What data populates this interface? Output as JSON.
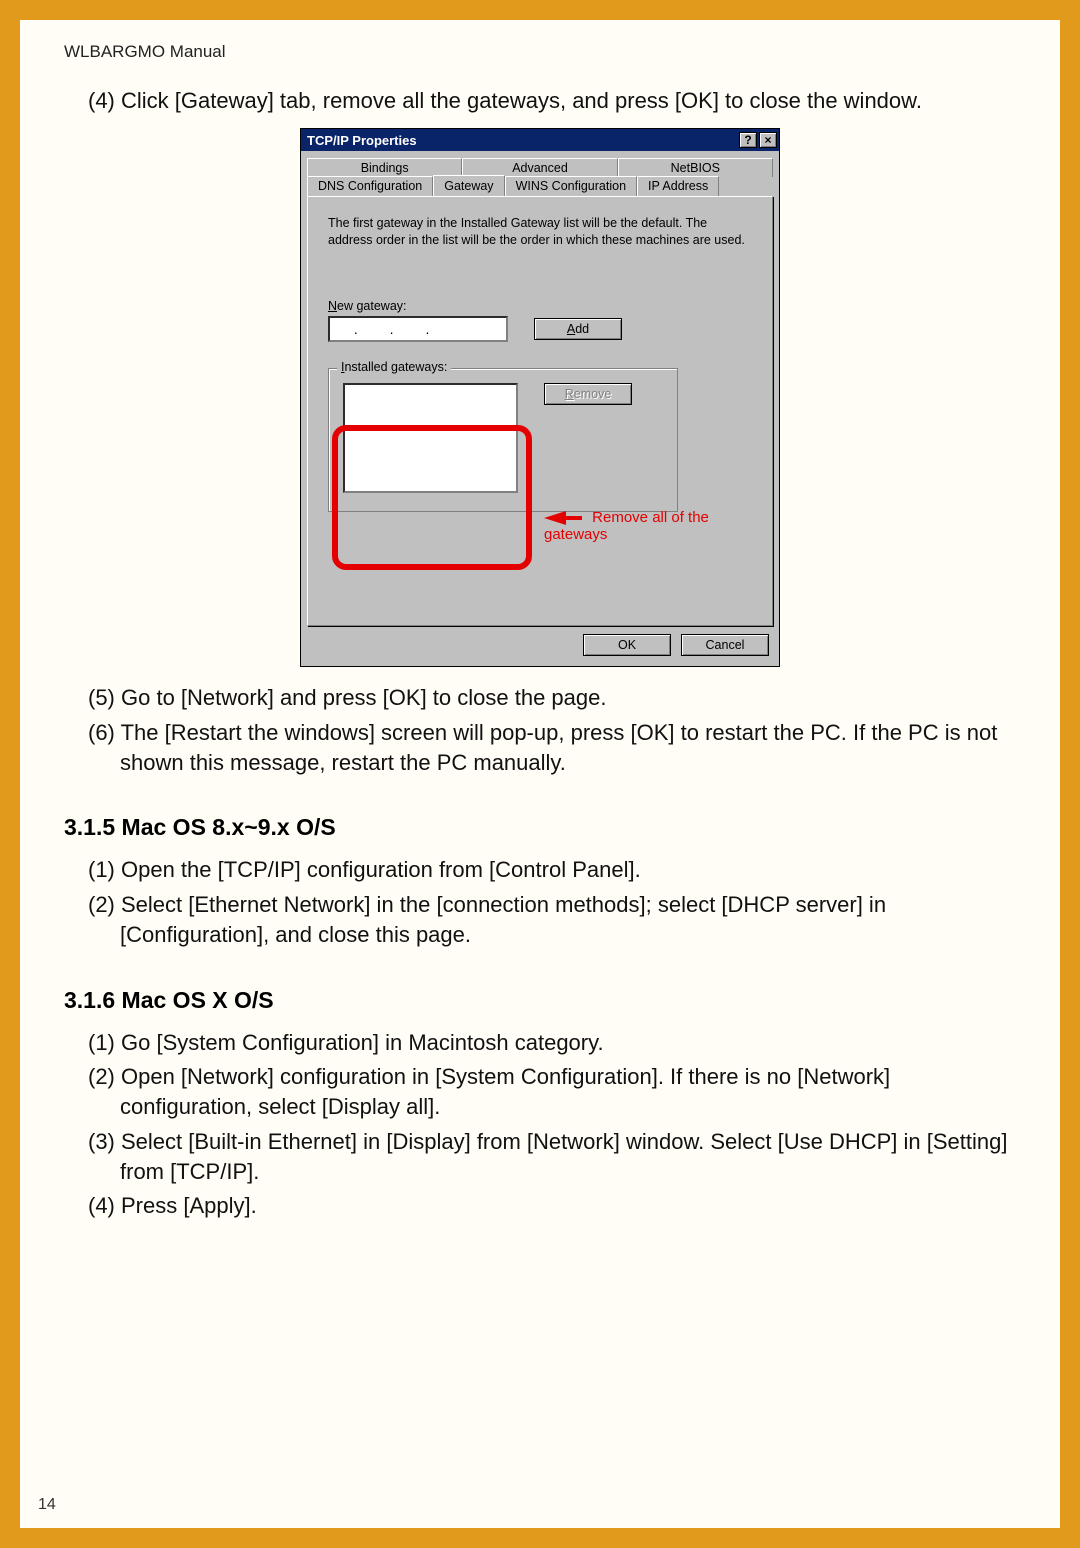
{
  "header": "WLBARGMO Manual",
  "page_number": "14",
  "steps_before": [
    "(4) Click [Gateway] tab, remove all the gateways, and press [OK] to close the window."
  ],
  "steps_after": [
    "(5) Go to [Network] and press [OK] to close the page.",
    "(6) The [Restart the windows] screen will pop-up, press [OK] to restart the PC. If the PC is not shown this message, restart the PC manually."
  ],
  "section_315": {
    "title": "3.1.5 Mac OS 8.x~9.x O/S",
    "items": [
      "(1) Open the [TCP/IP] configuration from [Control Panel].",
      "(2) Select [Ethernet Network] in the [connection methods]; select [DHCP server] in [Configuration], and close this page."
    ]
  },
  "section_316": {
    "title": "3.1.6 Mac OS X O/S",
    "items": [
      "(1) Go [System Configuration] in Macintosh category.",
      "(2) Open [Network] configuration in [System Configuration]. If there is no [Network] configuration, select [Display all].",
      "(3) Select [Built-in Ethernet] in [Display] from [Network] window. Select [Use DHCP] in [Setting] from [TCP/IP].",
      "(4) Press [Apply]."
    ]
  },
  "dialog": {
    "title": "TCP/IP Properties",
    "help_btn": "?",
    "close_btn": "×",
    "tabs_top": [
      "Bindings",
      "Advanced",
      "NetBIOS"
    ],
    "tabs_bottom": [
      "DNS Configuration",
      "Gateway",
      "WINS Configuration",
      "IP Address"
    ],
    "active_tab": "Gateway",
    "description": "The first gateway in the Installed Gateway list will be the default. The address order in the list will be the order in which these machines are used.",
    "new_gateway_label": "New gateway:",
    "add_btn": "Add",
    "installed_label": "Installed gateways:",
    "remove_btn": "Remove",
    "callout": "Remove all of the gateways",
    "ok_btn": "OK",
    "cancel_btn": "Cancel"
  }
}
